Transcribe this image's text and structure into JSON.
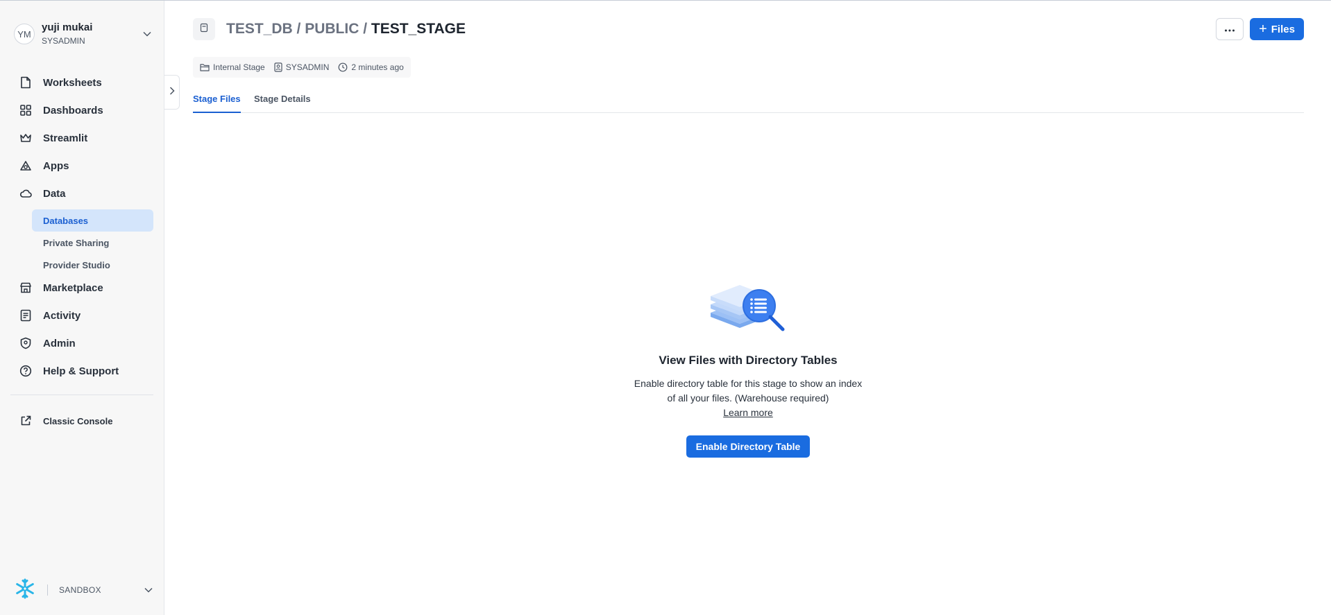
{
  "user": {
    "initials": "YM",
    "name": "yuji mukai",
    "role": "SYSADMIN"
  },
  "nav": {
    "items": [
      {
        "label": "Worksheets",
        "icon": "document-icon"
      },
      {
        "label": "Dashboards",
        "icon": "grid-icon"
      },
      {
        "label": "Streamlit",
        "icon": "crown-icon"
      },
      {
        "label": "Apps",
        "icon": "apps-icon"
      },
      {
        "label": "Data",
        "icon": "cloud-icon"
      }
    ],
    "data_sub": [
      {
        "label": "Databases",
        "active": true
      },
      {
        "label": "Private Sharing",
        "active": false
      },
      {
        "label": "Provider Studio",
        "active": false
      }
    ],
    "items_after": [
      {
        "label": "Marketplace",
        "icon": "store-icon"
      },
      {
        "label": "Activity",
        "icon": "activity-icon"
      },
      {
        "label": "Admin",
        "icon": "shield-icon"
      },
      {
        "label": "Help & Support",
        "icon": "help-icon"
      }
    ],
    "classic_console": "Classic Console"
  },
  "footer": {
    "account": "SANDBOX"
  },
  "header": {
    "breadcrumb_db": "TEST_DB",
    "breadcrumb_sep": " / ",
    "breadcrumb_schema": "PUBLIC",
    "breadcrumb_stage": "TEST_STAGE",
    "files_button": "Files"
  },
  "meta": {
    "stage_type": "Internal Stage",
    "owner": "SYSADMIN",
    "created": "2 minutes ago"
  },
  "tabs": [
    {
      "label": "Stage Files",
      "active": true
    },
    {
      "label": "Stage Details",
      "active": false
    }
  ],
  "empty_state": {
    "title": "View Files with Directory Tables",
    "description": "Enable directory table for this stage to show an index of all your files. (Warehouse required)",
    "link": "Learn more",
    "button": "Enable Directory Table"
  },
  "colors": {
    "accent": "#1a6ce0",
    "active_bg": "#d4e5fb",
    "brand_snowflake": "#29b5e8"
  }
}
